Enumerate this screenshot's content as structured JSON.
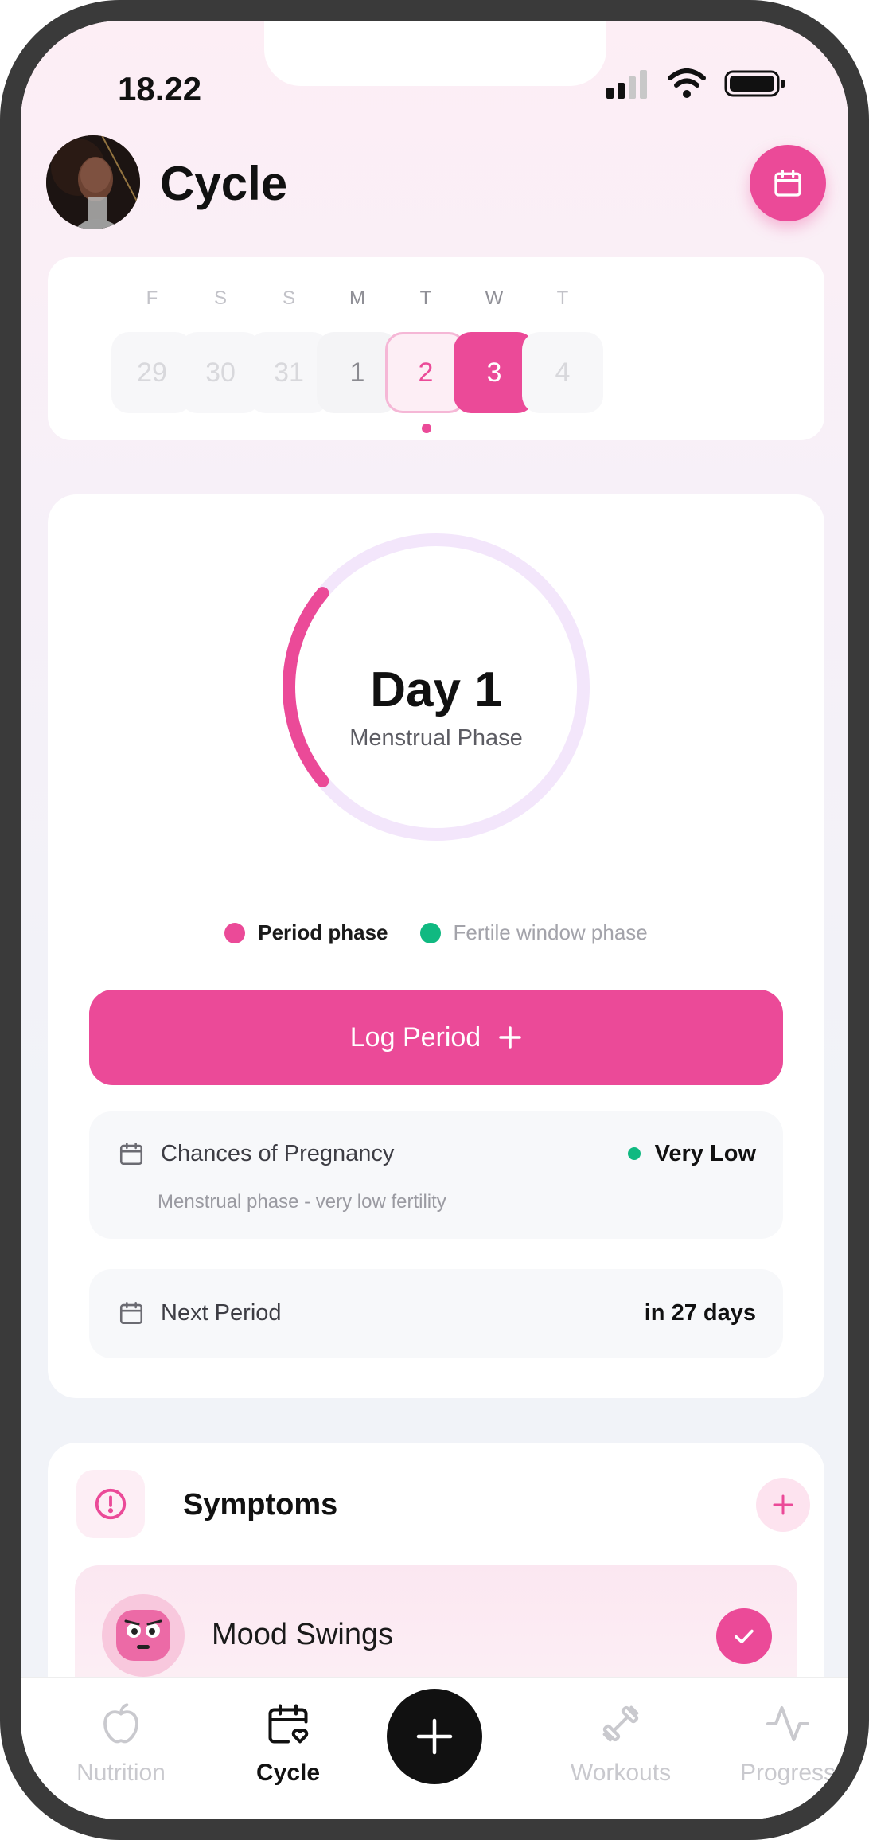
{
  "status_bar": {
    "time": "18.22"
  },
  "header": {
    "title": "Cycle"
  },
  "week": [
    {
      "letter": "F",
      "date": "29",
      "state": "past"
    },
    {
      "letter": "S",
      "date": "30",
      "state": "past"
    },
    {
      "letter": "S",
      "date": "31",
      "state": "past"
    },
    {
      "letter": "M",
      "date": "1",
      "state": "mid"
    },
    {
      "letter": "T",
      "date": "2",
      "state": "today"
    },
    {
      "letter": "W",
      "date": "3",
      "state": "selected"
    },
    {
      "letter": "T",
      "date": "4",
      "state": "future"
    }
  ],
  "cycle": {
    "day_label": "Day 1",
    "phase": "Menstrual Phase",
    "period_arc_fraction": 0.22
  },
  "legend": {
    "period": "Period phase",
    "fertile": "Fertile window phase"
  },
  "log_button": {
    "label": "Log Period",
    "icon": "plus-icon"
  },
  "pregnancy": {
    "label": "Chances of Pregnancy",
    "value": "Very Low",
    "note": "Menstrual phase - very low fertility"
  },
  "next_period": {
    "label": "Next Period",
    "value": "in 27 days"
  },
  "symptoms": {
    "title": "Symptoms",
    "items": [
      {
        "name": "Mood Swings"
      }
    ]
  },
  "tabs": [
    {
      "label": "Nutrition",
      "icon": "apple-icon"
    },
    {
      "label": "Cycle",
      "icon": "calendar-heart-icon"
    },
    {
      "label": "Workouts",
      "icon": "dumbbell-icon"
    },
    {
      "label": "Progress",
      "icon": "activity-icon"
    }
  ],
  "colors": {
    "accent": "#eb4a98",
    "fertile": "#10b981",
    "ring_track": "#f3e6fb"
  }
}
